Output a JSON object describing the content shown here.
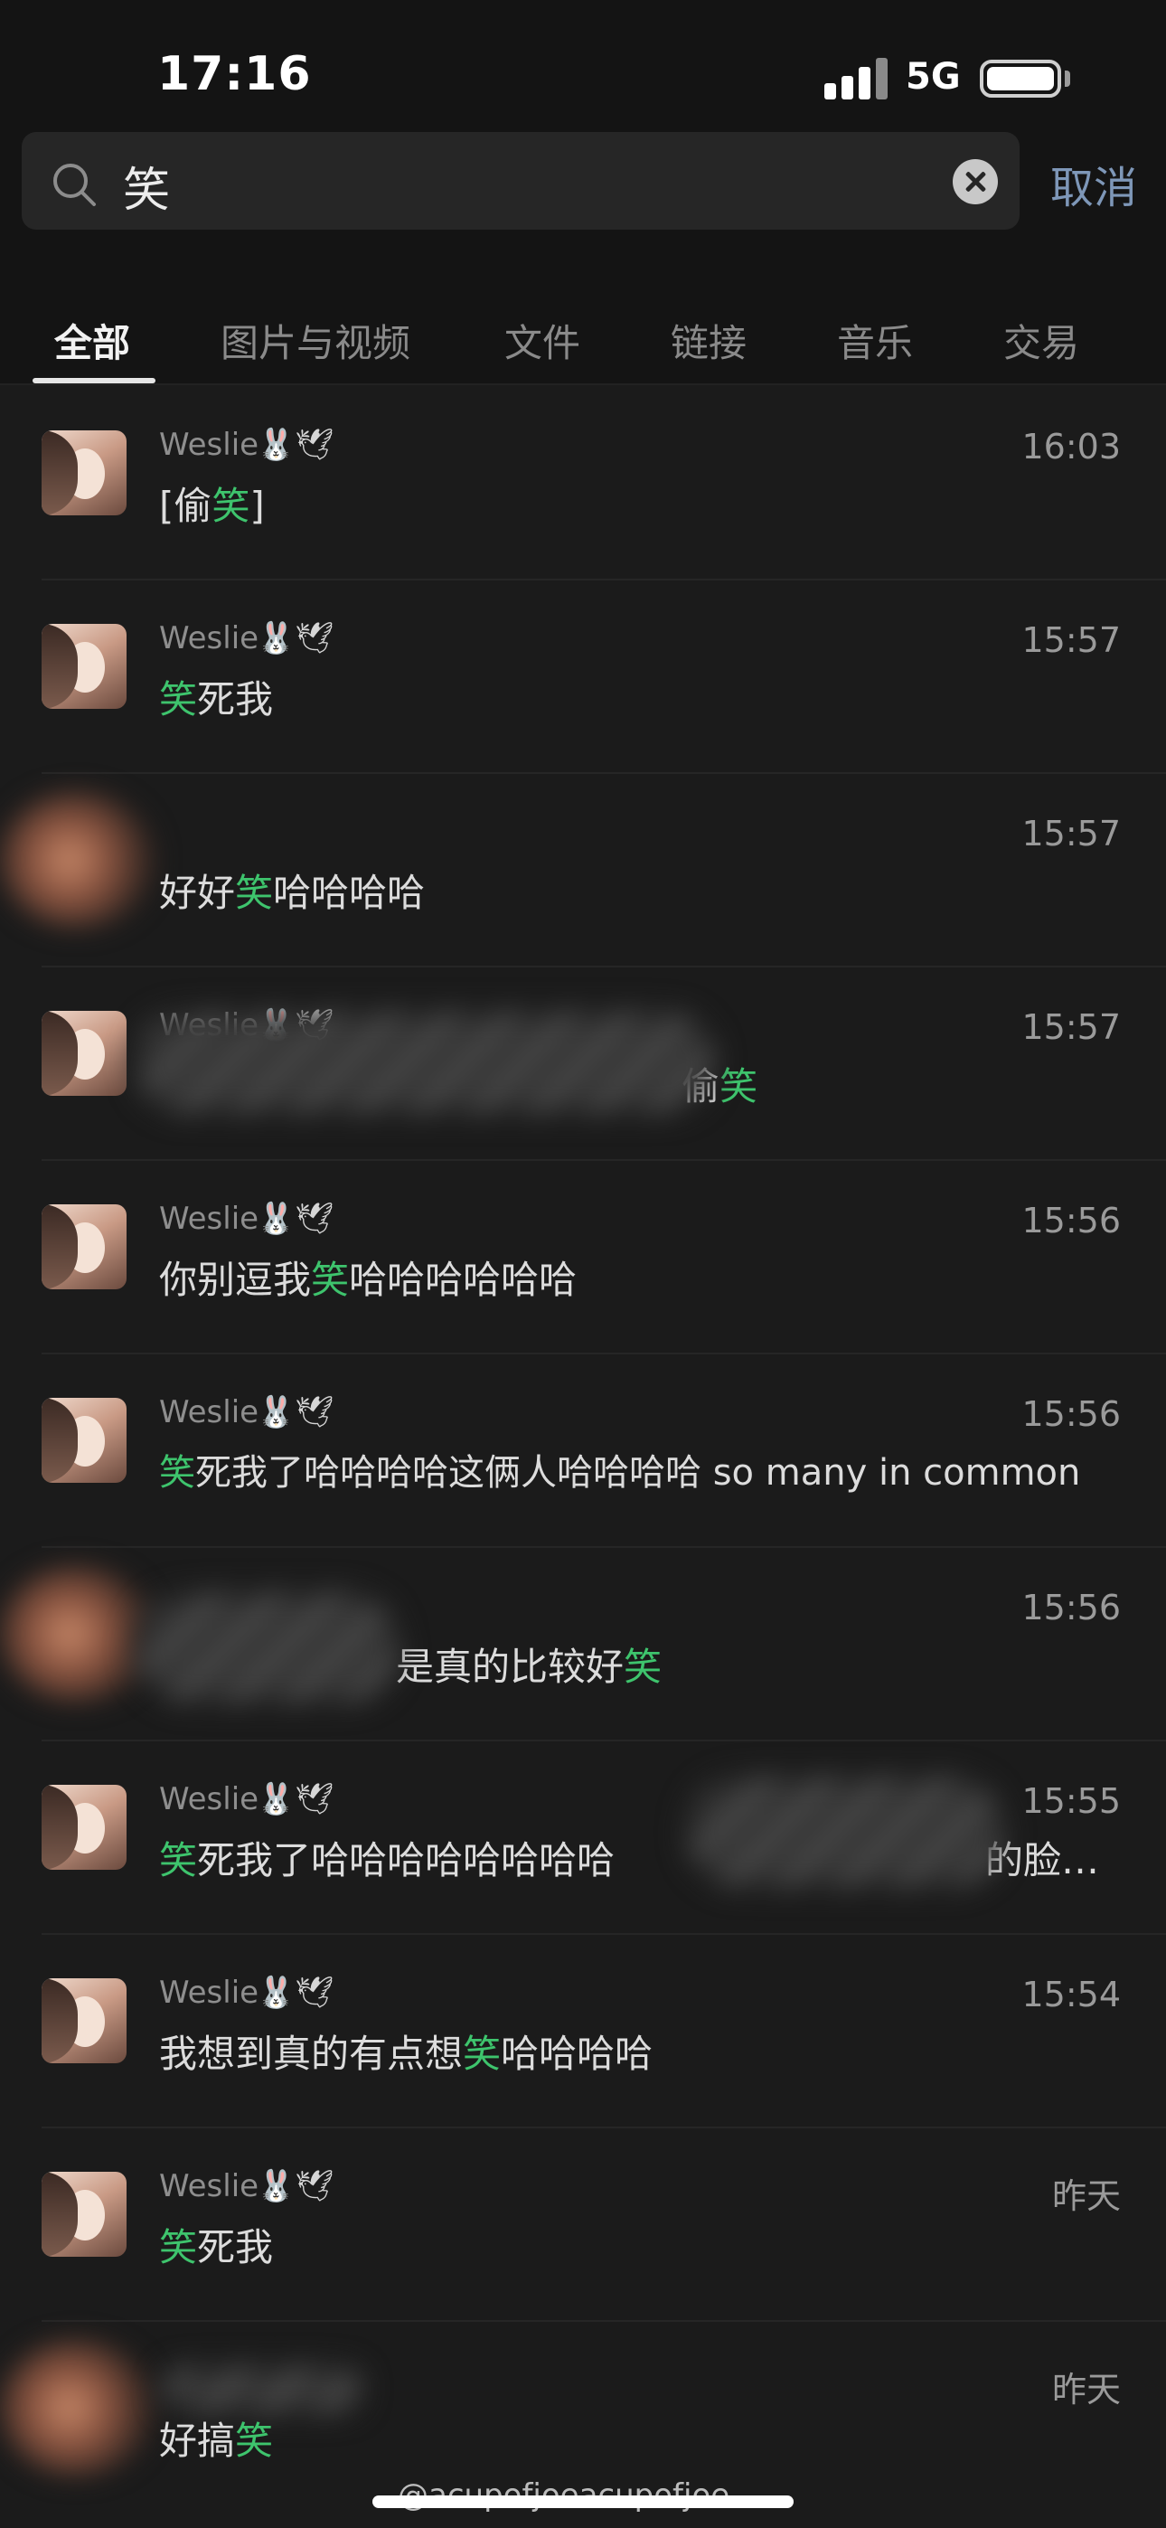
{
  "status_bar": {
    "time": "17:16",
    "network": "5G"
  },
  "search": {
    "query": "笑",
    "cancel_label": "取消"
  },
  "tabs": [
    {
      "label": "全部",
      "active": true
    },
    {
      "label": "图片与视频",
      "active": false
    },
    {
      "label": "文件",
      "active": false
    },
    {
      "label": "链接",
      "active": false
    },
    {
      "label": "音乐",
      "active": false
    },
    {
      "label": "交易",
      "active": false
    }
  ],
  "highlight_color": "#3ec46d",
  "results": [
    {
      "sender": "Weslie",
      "sender_emoji": "🐰🕊",
      "time": "16:03",
      "pre": "[偷",
      "hl": "笑",
      "post": "]",
      "avatar": "profile-photo"
    },
    {
      "sender": "Weslie",
      "sender_emoji": "🐰🕊",
      "time": "15:57",
      "pre": "",
      "hl": "笑",
      "post": "死我",
      "avatar": "profile-photo"
    },
    {
      "sender": "",
      "sender_emoji": "",
      "time": "15:57",
      "pre": "好好",
      "hl": "笑",
      "post": "哈哈哈哈",
      "avatar": "blurred"
    },
    {
      "sender": "Weslie",
      "sender_emoji": "🐰🕊",
      "time": "15:57",
      "pre": "偷",
      "hl": "笑",
      "post": "",
      "avatar": "profile-photo",
      "message_redacted": true
    },
    {
      "sender": "Weslie",
      "sender_emoji": "🐰🕊",
      "time": "15:56",
      "pre": "你别逗我",
      "hl": "笑",
      "post": "哈哈哈哈哈哈",
      "avatar": "profile-photo"
    },
    {
      "sender": "Weslie",
      "sender_emoji": "🐰🕊",
      "time": "15:56",
      "pre": "",
      "hl": "笑",
      "post": "死我了哈哈哈哈这俩人哈哈哈哈 so many in common",
      "avatar": "profile-photo"
    },
    {
      "sender": "",
      "sender_emoji": "",
      "time": "15:56",
      "pre": "是真的比较好",
      "hl": "笑",
      "post": "",
      "avatar": "blurred",
      "message_redacted": true
    },
    {
      "sender": "Weslie",
      "sender_emoji": "🐰🕊",
      "time": "15:55",
      "pre": "",
      "hl": "笑",
      "post": "死我了哈哈哈哈哈哈哈哈",
      "tail": "的脸…",
      "avatar": "profile-photo",
      "message_redacted": true
    },
    {
      "sender": "Weslie",
      "sender_emoji": "🐰🕊",
      "time": "15:54",
      "pre": "我想到真的有点想",
      "hl": "笑",
      "post": "哈哈哈哈",
      "avatar": "profile-photo"
    },
    {
      "sender": "Weslie",
      "sender_emoji": "🐰🕊",
      "time": "昨天",
      "pre": "",
      "hl": "笑",
      "post": "死我",
      "avatar": "profile-photo"
    },
    {
      "sender": "",
      "sender_emoji": "",
      "time": "昨天",
      "pre": "好搞",
      "hl": "笑",
      "post": "",
      "avatar": "blurred"
    }
  ],
  "watermark": "@acupofjoeacupofjoe"
}
